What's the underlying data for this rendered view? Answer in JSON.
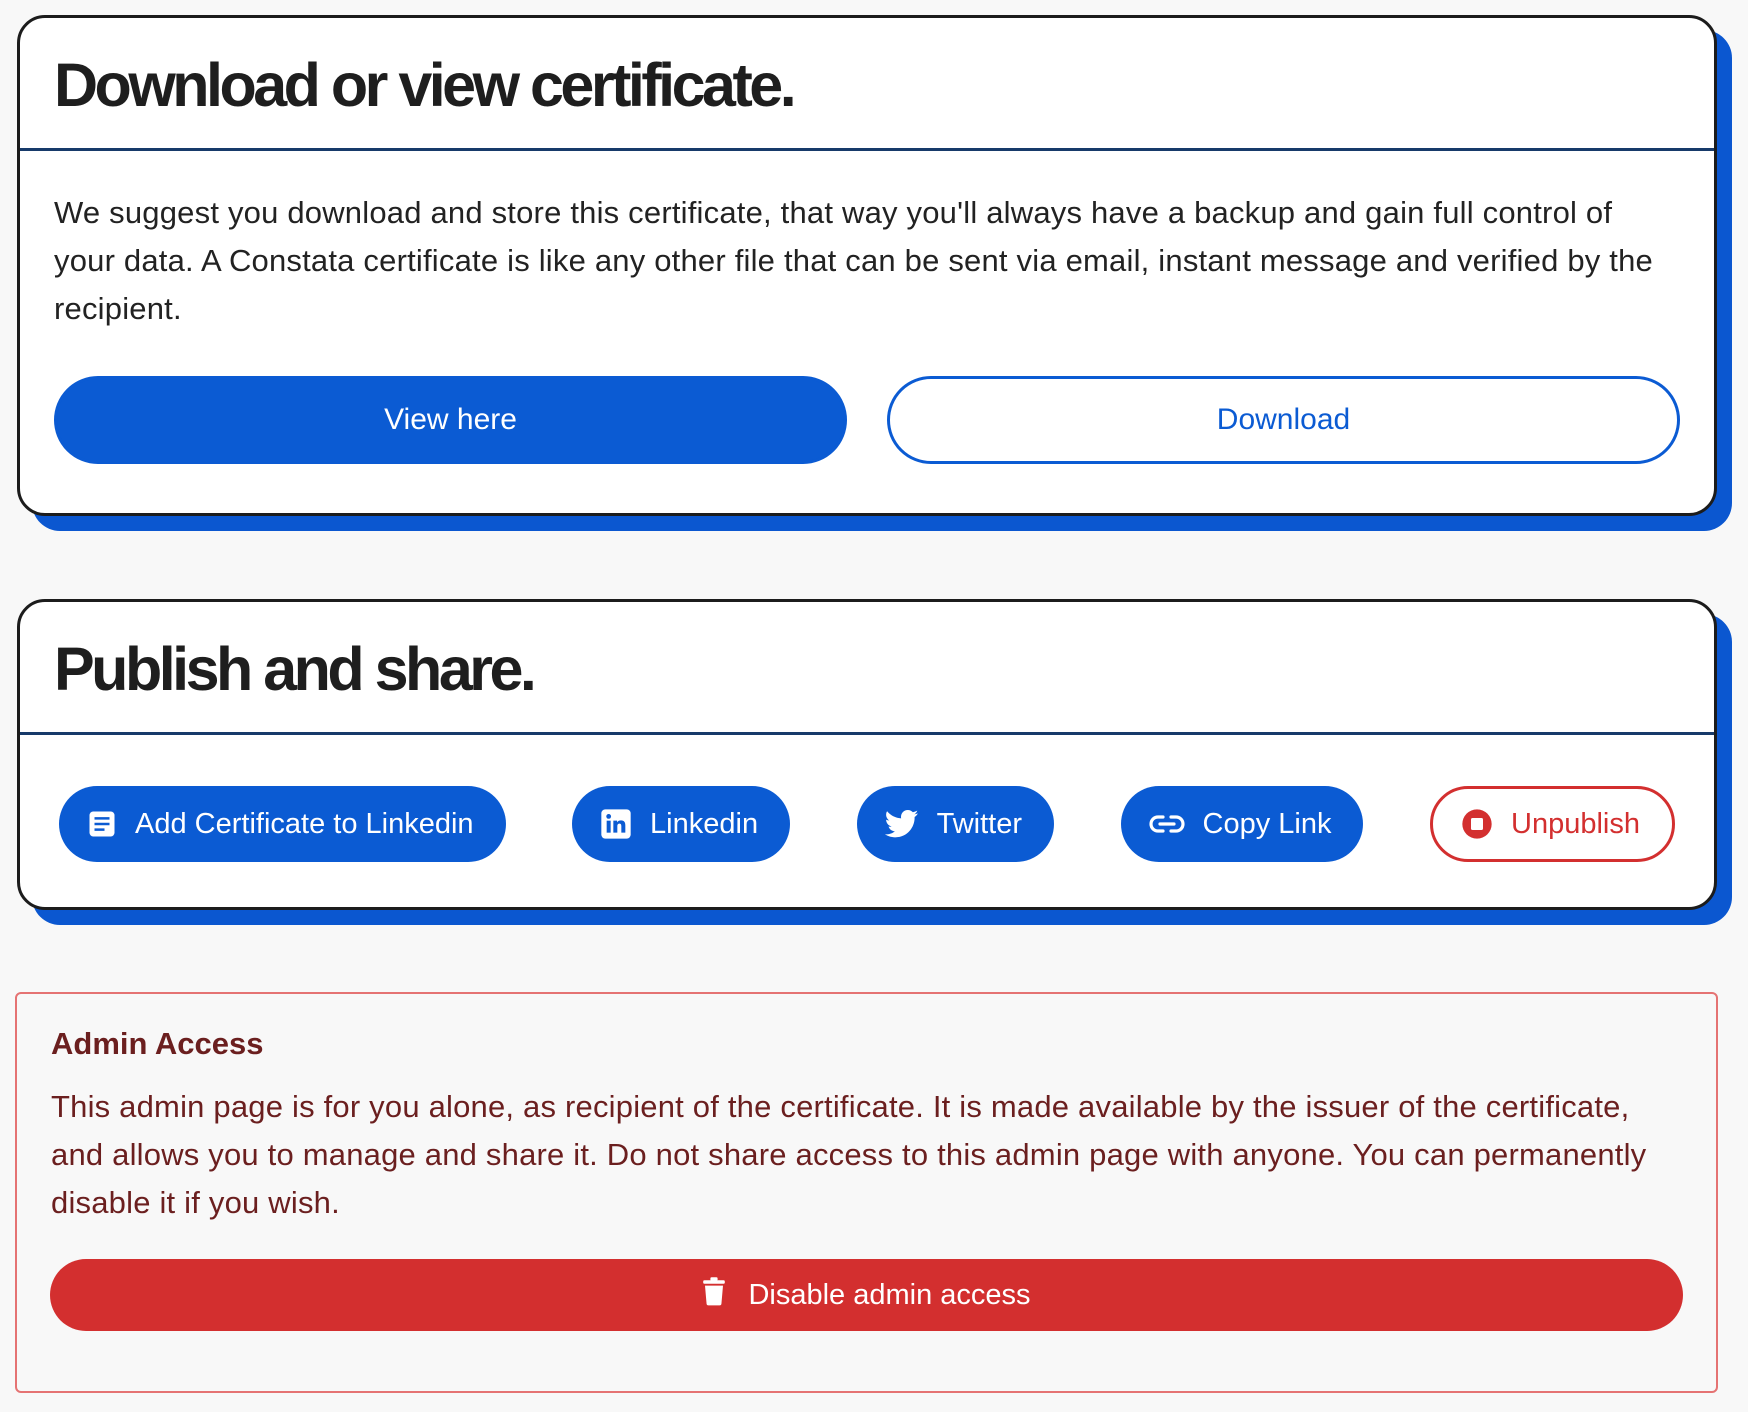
{
  "download_card": {
    "title": "Download or view certificate.",
    "description": "We suggest you download and store this certificate, that way you'll always have a backup and gain full control of your data. A Constata certificate is like any other file that can be sent via email, instant message and verified by the recipient.",
    "view_label": "View here",
    "download_label": "Download"
  },
  "publish_card": {
    "title": "Publish and share.",
    "buttons": {
      "add_linkedin": "Add Certificate to Linkedin",
      "linkedin": "Linkedin",
      "twitter": "Twitter",
      "copy_link": "Copy Link",
      "unpublish": "Unpublish"
    }
  },
  "admin": {
    "title": "Admin Access",
    "description": "This admin page is for you alone, as recipient of the certificate. It is made available by the issuer of the certificate, and allows you to manage and share it. Do not share access to this admin page with anyone. You can permanently disable it if you wish.",
    "disable_label": "Disable admin access"
  },
  "colors": {
    "primary": "#0b5bd3",
    "danger": "#d32f2f",
    "admin_text": "#6b1f1f",
    "card_border": "#1c1c1c"
  },
  "icons": {
    "add_linkedin": "document-icon",
    "linkedin": "linkedin-icon",
    "twitter": "twitter-icon",
    "copy_link": "link-icon",
    "unpublish": "stop-icon",
    "disable": "trash-icon"
  }
}
